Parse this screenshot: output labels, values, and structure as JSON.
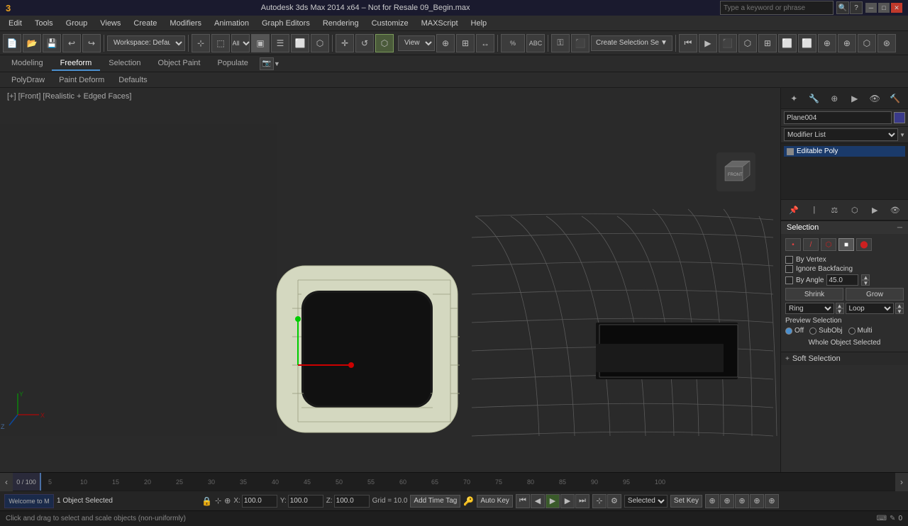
{
  "titlebar": {
    "app_icon": "3dsmax-icon",
    "title": "Autodesk 3ds Max 2014 x64 – Not for Resale   09_Begin.max",
    "search_placeholder": "Type a keyword or phrase"
  },
  "menubar": {
    "items": [
      "Edit",
      "Tools",
      "Group",
      "Views",
      "Create",
      "Modifiers",
      "Animation",
      "Graph Editors",
      "Rendering",
      "Customize",
      "MAXScript",
      "Help"
    ]
  },
  "toolbar": {
    "workspace_label": "Workspace: Default",
    "view_label": "View",
    "create_selection_label": "Create Selection Se",
    "filter_label": "All"
  },
  "sub_toolbar": {
    "tabs": [
      "Modeling",
      "Freeform",
      "Selection",
      "Object Paint",
      "Populate"
    ]
  },
  "sub_sub_toolbar": {
    "items": [
      "PolyDraw",
      "Paint Deform",
      "Defaults"
    ]
  },
  "viewport": {
    "label": "[+] [Front] [Realistic + Edged Faces]",
    "front_label": "FRONT"
  },
  "right_panel": {
    "object_name": "Plane004",
    "modifier_list_label": "Modifier List",
    "modifier_stack": [
      "Editable Poly"
    ],
    "sections": {
      "selection": {
        "title": "Selection",
        "by_vertex_label": "By Vertex",
        "ignore_backfacing_label": "Ignore Backfacing",
        "by_angle_label": "By Angle",
        "by_angle_value": "45.0",
        "shrink_label": "Shrink",
        "grow_label": "Grow",
        "ring_label": "Ring",
        "loop_label": "Loop",
        "preview_selection_label": "Preview Selection",
        "off_label": "Off",
        "subobj_label": "SubObj",
        "multi_label": "Multi",
        "whole_object_label": "Whole Object Selected"
      },
      "soft_selection": {
        "title": "Soft Selection"
      }
    }
  },
  "status_bar": {
    "objects_selected": "1 Object Selected",
    "hint": "Click and drag to select and scale objects (non-uniformly)",
    "x_value": "100.0",
    "y_value": "100.0",
    "z_value": "100.0",
    "grid_value": "Grid = 10.0",
    "add_time_tag": "Add Time Tag",
    "auto_key_label": "Auto Key",
    "set_key_label": "Set Key",
    "selected_label": "Selected"
  },
  "timeline": {
    "current": "0 / 100",
    "ticks": [
      "0",
      "5",
      "10",
      "15",
      "20",
      "25",
      "30",
      "35",
      "40",
      "45",
      "50",
      "55",
      "60",
      "65",
      "70",
      "75",
      "80",
      "85",
      "90",
      "95",
      "100"
    ]
  }
}
